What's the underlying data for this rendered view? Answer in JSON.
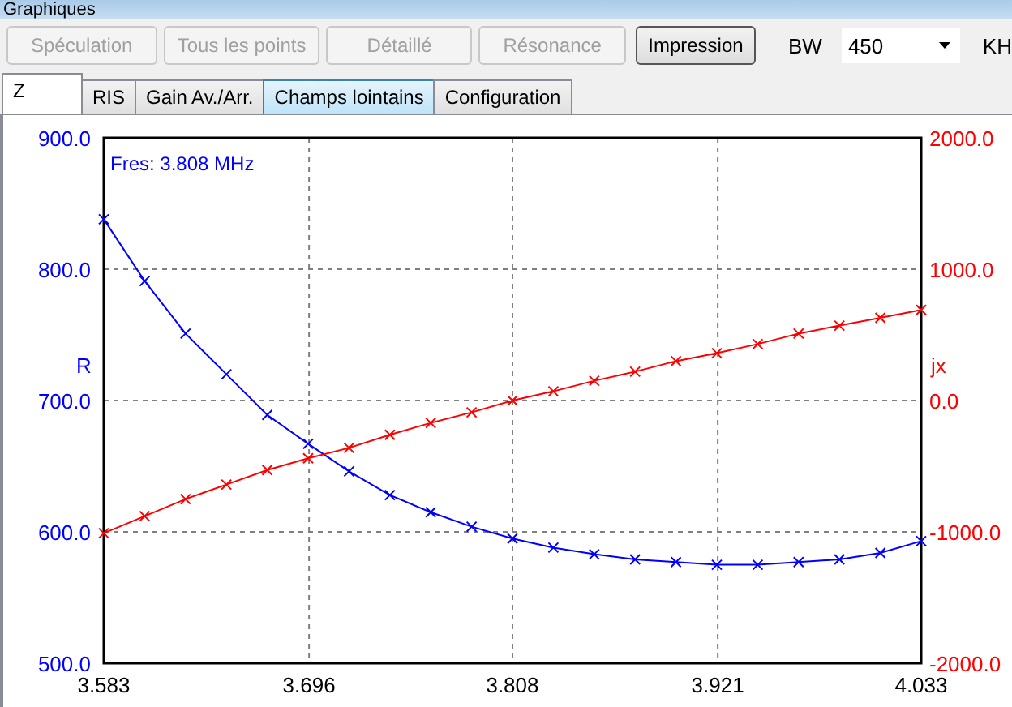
{
  "window": {
    "title": "Graphiques"
  },
  "buttons": [
    {
      "label": "Spéculation",
      "disabled": true
    },
    {
      "label": "Tous les points",
      "disabled": true
    },
    {
      "label": "Détaillé",
      "disabled": true
    },
    {
      "label": "Résonance",
      "disabled": true
    },
    {
      "label": "Impression",
      "disabled": false
    }
  ],
  "bandwidth": {
    "label": "BW",
    "value": "450",
    "unit": "KH"
  },
  "tabs": [
    {
      "label": "Z",
      "selected": true,
      "hovered": false
    },
    {
      "label": "RIS",
      "selected": false,
      "hovered": false
    },
    {
      "label": "Gain Av./Arr.",
      "selected": false,
      "hovered": false
    },
    {
      "label": "Champs lointains",
      "selected": false,
      "hovered": true
    },
    {
      "label": "Configuration",
      "selected": false,
      "hovered": false
    }
  ],
  "chart": {
    "chart_data": {
      "type": "line",
      "grid": true,
      "x": [
        3.583,
        3.6055,
        3.628,
        3.6505,
        3.673,
        3.6955,
        3.718,
        3.7405,
        3.763,
        3.7855,
        3.808,
        3.8305,
        3.853,
        3.8755,
        3.898,
        3.9205,
        3.943,
        3.9655,
        3.988,
        4.0105,
        4.033
      ],
      "series": [
        {
          "name": "R",
          "color": "#0000ff",
          "marker": "x",
          "values": [
            838,
            791,
            751,
            720,
            689,
            667,
            646,
            628,
            615,
            604,
            595,
            588,
            583,
            579,
            577,
            575,
            575,
            577,
            579,
            584,
            593
          ]
        },
        {
          "name": "jx",
          "color": "#ff0000",
          "axis": "y2",
          "marker": "x",
          "values": [
            -1010,
            -880,
            -750,
            -640,
            -530,
            -440,
            -360,
            -260,
            -170,
            -90,
            0,
            70,
            150,
            220,
            300,
            360,
            430,
            510,
            570,
            630,
            690
          ]
        }
      ],
      "xlim": [
        3.583,
        4.033
      ],
      "ylim": [
        500,
        900
      ],
      "y2lim": [
        -2000,
        2000
      ],
      "xticks": [
        {
          "value": 3.583,
          "label": "3.583"
        },
        {
          "value": 3.696,
          "label": "3.696"
        },
        {
          "value": 3.808,
          "label": "3.808"
        },
        {
          "value": 3.921,
          "label": "3.921"
        },
        {
          "value": 4.033,
          "label": "4.033"
        }
      ],
      "yticks": [
        {
          "value": 500,
          "label": "500.0"
        },
        {
          "value": 600,
          "label": "600.0"
        },
        {
          "value": 700,
          "label": "700.0"
        },
        {
          "value": 800,
          "label": "800.0"
        },
        {
          "value": 900,
          "label": "900.0"
        }
      ],
      "y2ticks": [
        {
          "value": -2000,
          "label": "-2000.0"
        },
        {
          "value": -1000,
          "label": "-1000.0"
        },
        {
          "value": 0,
          "label": "0.0"
        },
        {
          "value": 1000,
          "label": "1000.0"
        },
        {
          "value": 2000,
          "label": "2000.0"
        }
      ],
      "annotations": [
        "Fres: 3.808 MHz"
      ]
    }
  }
}
